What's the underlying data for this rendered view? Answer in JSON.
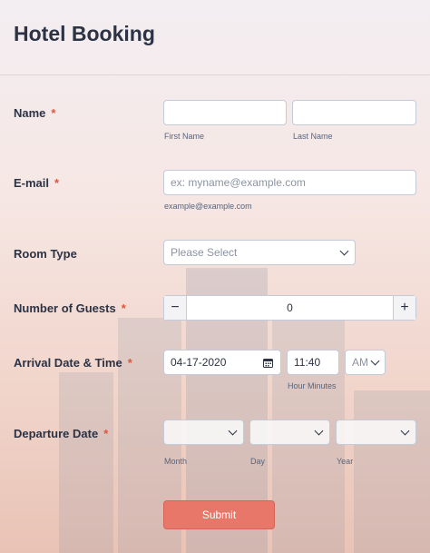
{
  "form": {
    "title": "Hotel Booking",
    "required_mark": "*"
  },
  "name": {
    "label": "Name",
    "first_sublabel": "First Name",
    "last_sublabel": "Last Name",
    "first_value": "",
    "last_value": ""
  },
  "email": {
    "label": "E-mail",
    "placeholder": "ex: myname@example.com",
    "sublabel": "example@example.com"
  },
  "room": {
    "label": "Room Type",
    "selected": "Please Select"
  },
  "guests": {
    "label": "Number of Guests",
    "value": "0",
    "minus": "−",
    "plus": "+"
  },
  "arrival": {
    "label": "Arrival Date & Time",
    "date": "04-17-2020",
    "time": "11:40",
    "ampm": "AM",
    "time_sublabel": "Hour Minutes"
  },
  "departure": {
    "label": "Departure Date",
    "month_sublabel": "Month",
    "day_sublabel": "Day",
    "year_sublabel": "Year"
  },
  "submit_label": "Submit",
  "icons": {
    "calendar": "calendar-icon",
    "chevron": "chevron-down-icon"
  }
}
